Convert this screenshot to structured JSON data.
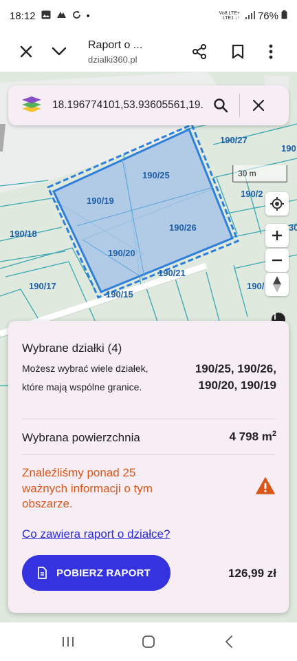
{
  "status_bar": {
    "time": "18:12",
    "dot": "•",
    "network_top": "Vo8 LTE+",
    "network_bottom": "LTE1 ↓↑",
    "battery": "76%"
  },
  "toolbar": {
    "title": "Raport o ...",
    "url": "dzialki360.pl"
  },
  "search": {
    "value": "18.196774101,53.93605561,19."
  },
  "map": {
    "scale_label": "30 m",
    "parcel_labels": [
      {
        "text": "190/27"
      },
      {
        "text": "190"
      },
      {
        "text": "190/25"
      },
      {
        "text": "190/2"
      },
      {
        "text": "190/19"
      },
      {
        "text": "190/26"
      },
      {
        "text": "190/18"
      },
      {
        "text": "30"
      },
      {
        "text": "190/20"
      },
      {
        "text": "190/21"
      },
      {
        "text": "190/17"
      },
      {
        "text": "190/"
      },
      {
        "text": "190/15"
      }
    ],
    "colors": {
      "background": "#dfe9de",
      "parcel_line": "#3aa7b3",
      "selection": "#2e7fd9",
      "selection_fill": "#a9c6e9"
    }
  },
  "sheet": {
    "title": "Wybrane działki (4)",
    "description": "Możesz wybrać wiele działek, które mają wspólne granice.",
    "parcels_line1": "190/25, 190/26,",
    "parcels_line2": "190/20, 190/19",
    "area_label": "Wybrana powierzchnia",
    "area_value": "4 798 m",
    "area_unit_sup": "2",
    "warning": "Znaleźliśmy ponad 25 ważnych informacji o tym obszarze.",
    "report_link": "Co zawiera raport o działce?",
    "download_label": "POBIERZ RAPORT",
    "price": "126,99 zł",
    "accent_color": "#3533e0",
    "warning_color": "#d9561b"
  },
  "icons": [
    "gallery-icon",
    "alarm-icon",
    "sync-icon",
    "signal-icon",
    "battery-icon",
    "close-icon",
    "chevron-down-icon",
    "share-icon",
    "bookmark-icon",
    "more-icon",
    "layers-icon",
    "search-icon",
    "location-icon",
    "compass-icon",
    "warning-icon",
    "document-icon",
    "recent-apps-icon",
    "home-icon",
    "back-icon"
  ]
}
